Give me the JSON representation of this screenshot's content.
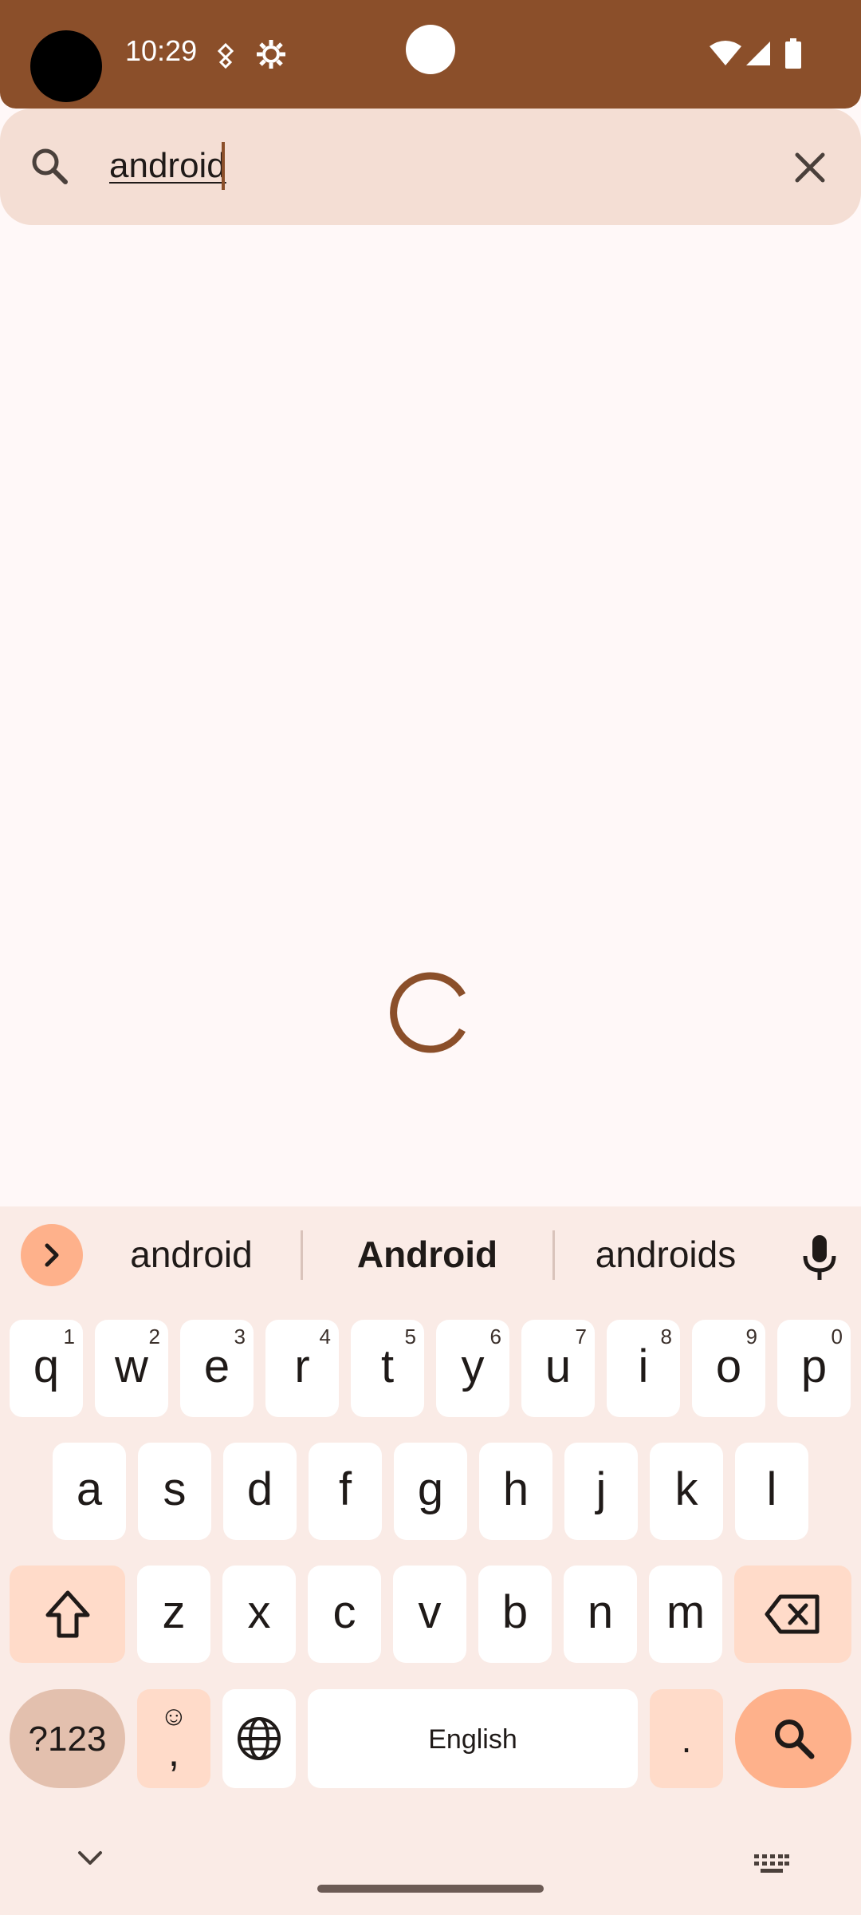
{
  "status": {
    "time": "10:29",
    "icons": [
      "fitness-icon",
      "settings-gear-icon",
      "wifi-icon",
      "cell-signal-icon",
      "battery-icon"
    ]
  },
  "search": {
    "query": "android",
    "icon": "search-icon",
    "clear_icon": "close-icon"
  },
  "loading": {
    "icon": "progress-spinner"
  },
  "keyboard": {
    "suggestions": [
      "android",
      "Android",
      "androids"
    ],
    "rows": [
      [
        {
          "k": "q",
          "h": "1"
        },
        {
          "k": "w",
          "h": "2"
        },
        {
          "k": "e",
          "h": "3"
        },
        {
          "k": "r",
          "h": "4"
        },
        {
          "k": "t",
          "h": "5"
        },
        {
          "k": "y",
          "h": "6"
        },
        {
          "k": "u",
          "h": "7"
        },
        {
          "k": "i",
          "h": "8"
        },
        {
          "k": "o",
          "h": "9"
        },
        {
          "k": "p",
          "h": "0"
        }
      ],
      [
        {
          "k": "a"
        },
        {
          "k": "s"
        },
        {
          "k": "d"
        },
        {
          "k": "f"
        },
        {
          "k": "g"
        },
        {
          "k": "h"
        },
        {
          "k": "j"
        },
        {
          "k": "k"
        },
        {
          "k": "l"
        }
      ],
      [
        {
          "k": "z"
        },
        {
          "k": "x"
        },
        {
          "k": "c"
        },
        {
          "k": "v"
        },
        {
          "k": "b"
        },
        {
          "k": "n"
        },
        {
          "k": "m"
        }
      ]
    ],
    "symbols_label": "?123",
    "comma_label": ",",
    "emoji_label": "☺",
    "space_label": "English",
    "period_label": ".",
    "colors": {
      "accent": "#feb18b",
      "function_key": "#ffdbc9",
      "background": "#faebe6",
      "brand": "#8b4f2a"
    }
  }
}
